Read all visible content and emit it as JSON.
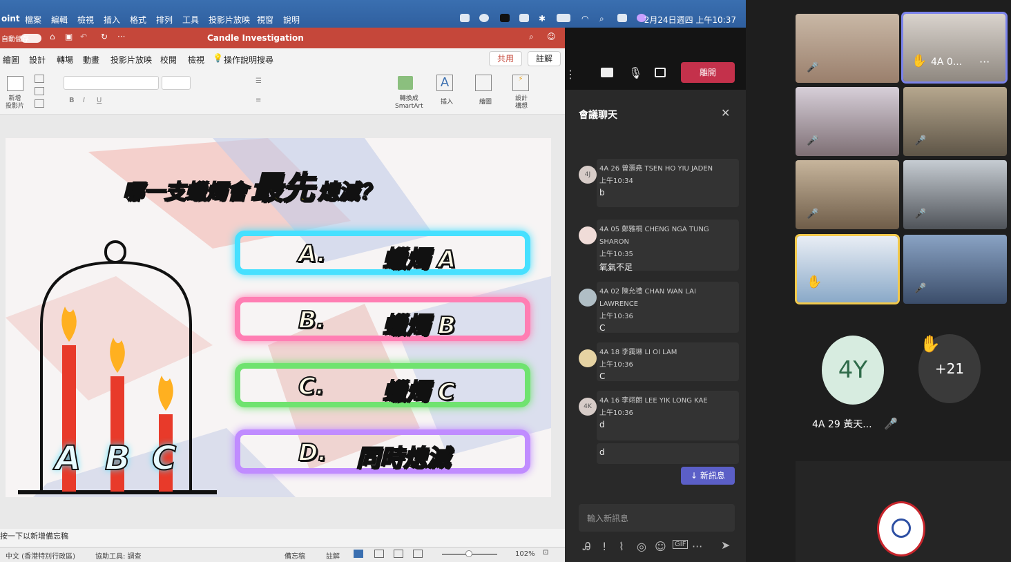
{
  "menubar": {
    "app": "oint",
    "items": [
      "檔案",
      "編輯",
      "檢視",
      "插入",
      "格式",
      "排列",
      "工具",
      "投影片放映",
      "視窗",
      "說明"
    ],
    "clock": "2月24日週四 上午10:37"
  },
  "ppt": {
    "autosave": "自動儲存",
    "doc_title": "Candle Investigation",
    "tabs": [
      "繪圖",
      "設計",
      "轉場",
      "動畫",
      "投影片放映",
      "校閱",
      "檢視"
    ],
    "tell_me": "操作說明搜尋",
    "share": "共用",
    "comment": "註解",
    "ribbon": {
      "new_slide": "新增\n投影片",
      "smartart": "轉換成\nSmartArt",
      "insert": "插入",
      "draw": "繪圖",
      "design": "設計\n構想"
    },
    "slide": {
      "question_a": "哪一支蠟燭會",
      "question_b": "最先",
      "question_c": "熄滅？",
      "options": [
        {
          "letter": "A.",
          "text": "蠟燭 A"
        },
        {
          "letter": "B.",
          "text": "蠟燭 B"
        },
        {
          "letter": "C.",
          "text": "蠟燭 C"
        },
        {
          "letter": "D.",
          "text": "同時熄滅"
        }
      ],
      "candle_labels": [
        "A",
        "B",
        "C"
      ],
      "colors": {
        "a": "#46e0ff",
        "b": "#ff7eb3",
        "c": "#6fe36f",
        "d": "#c08cff"
      }
    },
    "notes": "按一下以新增備忘稿",
    "status": {
      "lang": "中文 (香港特別行政區)",
      "access": "協助工具: 調查",
      "notes_btn": "備忘稿",
      "comments_btn": "註解",
      "zoom": "102%"
    }
  },
  "teams": {
    "leave": "離開",
    "chat_title": "會議聊天",
    "messages": [
      {
        "avatar": "4J",
        "name": "4A 26 曾灝堯 TSEN HO YIU JADEN",
        "time": "上午10:34",
        "text": "b"
      },
      {
        "avatar": "",
        "name": "4A 05 鄭雅桐 CHENG NGA TUNG SHARON",
        "time": "上午10:35",
        "text": "氧氣不足"
      },
      {
        "avatar": "",
        "name": "4A 02 陳允禮 CHAN WAN LAI LAWRENCE",
        "time": "上午10:36",
        "text": "C"
      },
      {
        "avatar": "",
        "name": "4A 18 李靄琳 LI OI LAM",
        "time": "上午10:36",
        "text": "C"
      },
      {
        "avatar": "4K",
        "name": "4A 16 李翊朗 LEE YIK LONG KAE",
        "time": "上午10:36",
        "text": "d"
      }
    ],
    "extra_text": "d",
    "new_messages": "新訊息",
    "input_placeholder": "輸入新訊息"
  },
  "grid": {
    "pinned_label": "4A 0...",
    "avatar_initials": "4Y",
    "avatar_name": "4A 29 黃天...",
    "more_count": "+21"
  }
}
